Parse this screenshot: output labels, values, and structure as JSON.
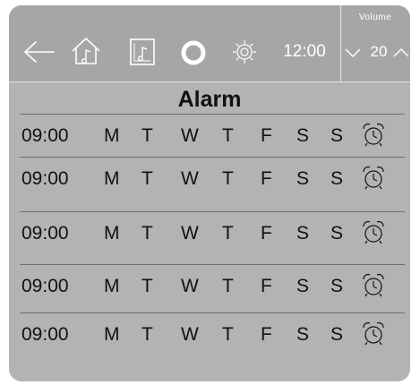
{
  "topbar": {
    "clock": "12:00",
    "volume_label": "Volume",
    "volume_value": "20"
  },
  "title": "Alarm",
  "alarms": [
    {
      "time": "09:00",
      "days": [
        "M",
        "T",
        "W",
        "T",
        "F",
        "S",
        "S"
      ]
    },
    {
      "time": "09:00",
      "days": [
        "M",
        "T",
        "W",
        "T",
        "F",
        "S",
        "S"
      ]
    },
    {
      "time": "09:00",
      "days": [
        "M",
        "T",
        "W",
        "T",
        "F",
        "S",
        "S"
      ]
    },
    {
      "time": "09:00",
      "days": [
        "M",
        "T",
        "W",
        "T",
        "F",
        "S",
        "S"
      ]
    },
    {
      "time": "09:00",
      "days": [
        "M",
        "T",
        "W",
        "T",
        "F",
        "S",
        "S"
      ]
    }
  ],
  "icons": {
    "back": "arrow-left-icon",
    "home": "home-music-icon",
    "music": "music-note-icon",
    "circle": "circle-icon",
    "settings": "gear-icon",
    "alarm": "alarm-clock-icon",
    "vol_down": "chevron-down-icon",
    "vol_up": "chevron-up-icon"
  },
  "colors": {
    "panel": "#b3b3b3",
    "topbar": "#a6a6a6",
    "icon": "#ffffff",
    "text": "#111111"
  }
}
